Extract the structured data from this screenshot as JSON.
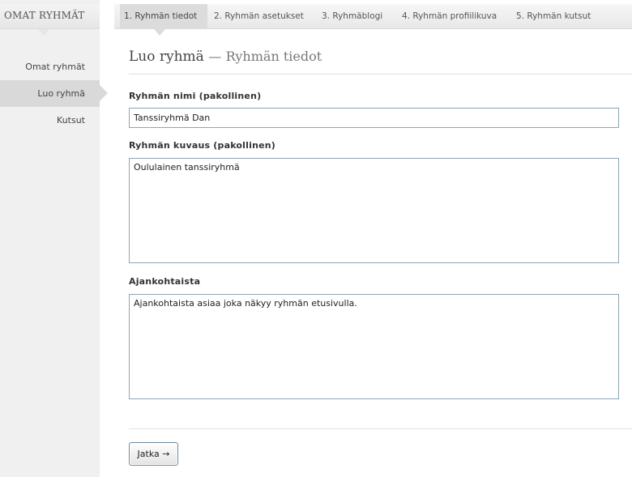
{
  "sidebar": {
    "title": "OMAT RYHMÄT",
    "items": [
      {
        "label": "Omat ryhmät",
        "active": false
      },
      {
        "label": "Luo ryhmä",
        "active": true
      },
      {
        "label": "Kutsut",
        "active": false
      }
    ]
  },
  "tabs": [
    {
      "label": "1. Ryhmän tiedot",
      "active": true
    },
    {
      "label": "2. Ryhmän asetukset",
      "active": false
    },
    {
      "label": "3. Ryhmäblogi",
      "active": false
    },
    {
      "label": "4. Ryhmän profiilikuva",
      "active": false
    },
    {
      "label": "5. Ryhmän kutsut",
      "active": false
    }
  ],
  "page": {
    "title": "Luo ryhmä",
    "separator": "—",
    "subtitle": "Ryhmän tiedot"
  },
  "form": {
    "name_label": "Ryhmän nimi (pakollinen)",
    "name_value": "Tanssiryhmä Dan",
    "description_label": "Ryhmän kuvaus (pakollinen)",
    "description_value": "Oululainen tanssiryhmä",
    "news_label": "Ajankohtaista",
    "news_value": "Ajankohtaista asiaa joka näkyy ryhmän etusivulla.",
    "submit_label": "Jatka →"
  },
  "colors": {
    "sidebar_bg": "#f0f0f0",
    "active_bg": "#d9d9d9",
    "field_border": "#8ea4b5"
  }
}
